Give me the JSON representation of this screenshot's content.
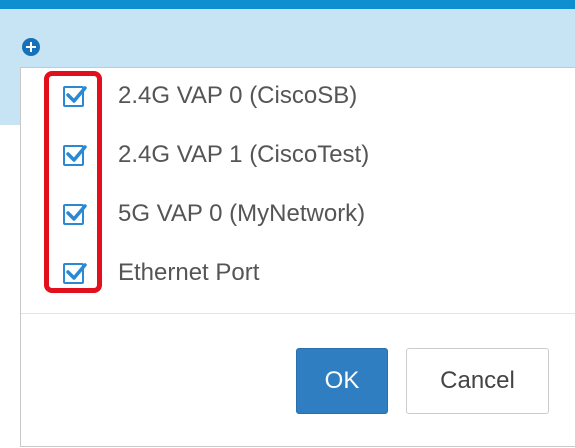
{
  "icons": {
    "add": "plus-circle-icon",
    "check": "checkmark-icon"
  },
  "colors": {
    "accent": "#2b89d4",
    "header_band": "#c7e4f4",
    "highlight": "#e2101c",
    "primary_button": "#2f7ec2"
  },
  "options": [
    {
      "label": "2.4G VAP 0 (CiscoSB)",
      "checked": true
    },
    {
      "label": "2.4G VAP 1 (CiscoTest)",
      "checked": true
    },
    {
      "label": "5G VAP 0 (MyNetwork)",
      "checked": true
    },
    {
      "label": "Ethernet Port",
      "checked": true
    }
  ],
  "buttons": {
    "ok_label": "OK",
    "cancel_label": "Cancel"
  }
}
